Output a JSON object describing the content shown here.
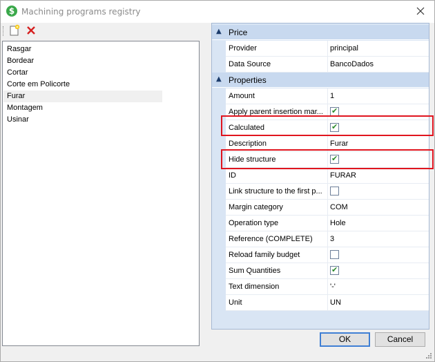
{
  "window": {
    "title": "Machining programs registry",
    "app_icon": "dollar-icon",
    "close_icon": "close-icon"
  },
  "toolbar": {
    "new_icon": "new-document-icon",
    "delete_icon": "delete-x-icon"
  },
  "programs": {
    "items": [
      "Rasgar",
      "Bordear",
      "Cortar",
      "Corte em Policorte",
      "Furar",
      "Montagem",
      "Usinar"
    ],
    "selected": "Furar"
  },
  "grid": {
    "categories": [
      {
        "label": "Price",
        "expanded": true,
        "properties": [
          {
            "name": "Provider",
            "value": "principal",
            "type": "text"
          },
          {
            "name": "Data Source",
            "value": "BancoDados",
            "type": "text"
          }
        ]
      },
      {
        "label": "Properties",
        "expanded": true,
        "properties": [
          {
            "name": "Amount",
            "value": "1",
            "type": "text"
          },
          {
            "name": "Apply parent insertion mar...",
            "value": true,
            "type": "checkbox"
          },
          {
            "name": "Calculated",
            "value": true,
            "type": "checkbox"
          },
          {
            "name": "Description",
            "value": "Furar",
            "type": "text"
          },
          {
            "name": "Hide structure",
            "value": true,
            "type": "checkbox"
          },
          {
            "name": "ID",
            "value": "FURAR",
            "type": "text"
          },
          {
            "name": "Link structure to the first p...",
            "value": false,
            "type": "checkbox"
          },
          {
            "name": "Margin category",
            "value": "COM",
            "type": "text"
          },
          {
            "name": "Operation type",
            "value": "Hole",
            "type": "text"
          },
          {
            "name": "Reference (COMPLETE)",
            "value": "3",
            "type": "text"
          },
          {
            "name": "Reload family budget",
            "value": false,
            "type": "checkbox"
          },
          {
            "name": "Sum Quantities",
            "value": true,
            "type": "checkbox"
          },
          {
            "name": "Text dimension",
            "value": "'-'",
            "type": "text"
          },
          {
            "name": "Unit",
            "value": "UN",
            "type": "text"
          }
        ]
      }
    ]
  },
  "highlighted_rows": [
    "Calculated",
    "Hide structure"
  ],
  "highlight_color": "#e0141e",
  "buttons": {
    "ok": "OK",
    "cancel": "Cancel"
  }
}
